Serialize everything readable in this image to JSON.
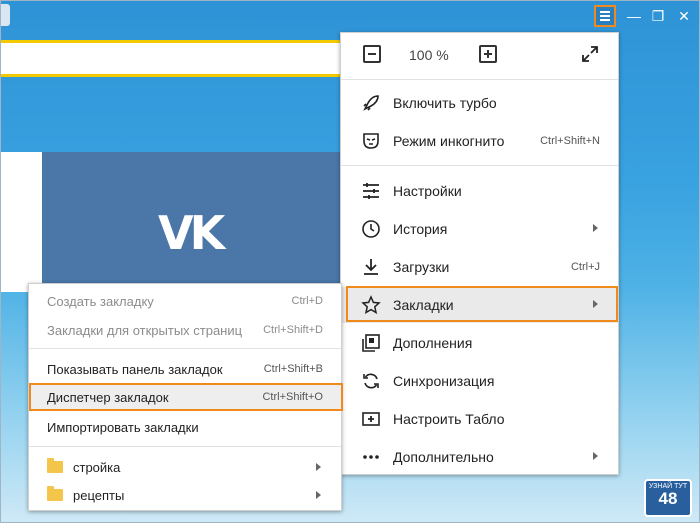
{
  "window": {
    "minimize_glyph": "—",
    "restore_glyph": "❐",
    "close_glyph": "✕"
  },
  "main_menu": {
    "zoom_value": "100 %",
    "items": [
      {
        "label": "Включить турбо",
        "icon": "rocket-icon"
      },
      {
        "label": "Режим инкогнито",
        "shortcut": "Ctrl+Shift+N",
        "icon": "incognito-mask-icon"
      },
      {
        "label": "Настройки",
        "icon": "settings-sliders-icon"
      },
      {
        "label": "История",
        "icon": "clock-icon",
        "has_submenu": true
      },
      {
        "label": "Загрузки",
        "shortcut": "Ctrl+J",
        "icon": "download-icon"
      },
      {
        "label": "Закладки",
        "icon": "star-icon",
        "has_submenu": true,
        "highlighted": true
      },
      {
        "label": "Дополнения",
        "icon": "extensions-icon"
      },
      {
        "label": "Синхронизация",
        "icon": "sync-icon"
      },
      {
        "label": "Настроить Табло",
        "icon": "plus-box-icon"
      },
      {
        "label": "Дополнительно",
        "icon": "more-dots-icon",
        "has_submenu": true
      }
    ]
  },
  "bookmarks_submenu": {
    "items": [
      {
        "label": "Создать закладку",
        "shortcut": "Ctrl+D",
        "disabled": true
      },
      {
        "label": "Закладки для открытых страниц",
        "shortcut": "Ctrl+Shift+D",
        "disabled": true
      },
      {
        "label": "Показывать панель закладок",
        "shortcut": "Ctrl+Shift+B"
      },
      {
        "label": "Диспетчер закладок",
        "shortcut": "Ctrl+Shift+O",
        "highlighted": true
      },
      {
        "label": "Импортировать закладки"
      }
    ],
    "folders": [
      {
        "label": "стройка"
      },
      {
        "label": "рецепты"
      }
    ]
  },
  "watermark": {
    "line1": "УЗНАЙ ТУТ",
    "line2": "48"
  },
  "colors": {
    "highlight": "#f08a1c",
    "vk_blue": "#4a76a8",
    "address_accent": "#f3c900"
  }
}
